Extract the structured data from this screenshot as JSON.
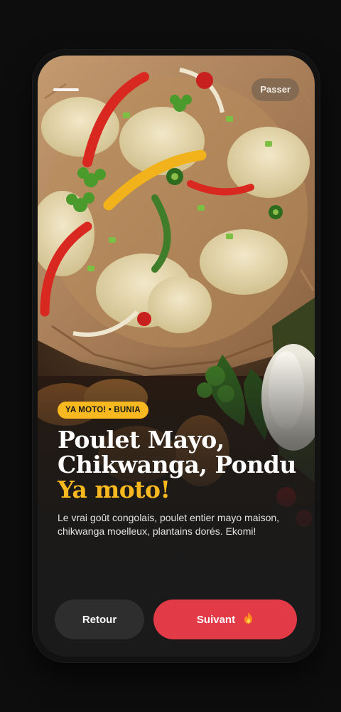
{
  "screen": {
    "skip_label": "Passer",
    "badge": "YA MOTO! • BUNIA",
    "title_line1": "Poulet Mayo,",
    "title_line2": "Chikwanga, Pondu",
    "title_accent": "Ya moto!",
    "description": "Le vrai goût congolais, poulet entier mayo maison, chikwanga moelleux, plantains dorés. Ekomi!",
    "progress": 0.33
  },
  "buttons": {
    "back_label": "Retour",
    "next_label": "Suivant",
    "next_icon": "fire-icon"
  },
  "colors": {
    "accent_yellow": "#f8b81f",
    "primary_red": "#e23a47",
    "button_dark": "#2e2e2e",
    "background": "#1a1a1a"
  }
}
